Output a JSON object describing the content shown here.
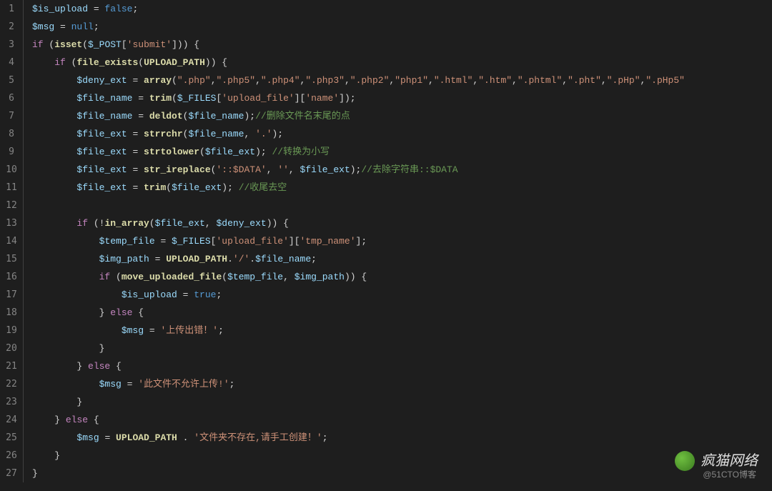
{
  "lineCount": 27,
  "code": {
    "l1": [
      [
        "var",
        "$is_upload"
      ],
      [
        "op",
        " = "
      ],
      [
        "bool",
        "false"
      ],
      [
        "punc",
        ";"
      ]
    ],
    "l2": [
      [
        "var",
        "$msg"
      ],
      [
        "op",
        " = "
      ],
      [
        "bool",
        "null"
      ],
      [
        "punc",
        ";"
      ]
    ],
    "l3": [
      [
        "kw",
        "if"
      ],
      [
        "punc",
        " ("
      ],
      [
        "fn",
        "isset"
      ],
      [
        "punc",
        "("
      ],
      [
        "var",
        "$_POST"
      ],
      [
        "punc",
        "["
      ],
      [
        "str",
        "'submit'"
      ],
      [
        "punc",
        "])) {"
      ]
    ],
    "l4": [
      [
        "plain",
        "    "
      ],
      [
        "kw",
        "if"
      ],
      [
        "punc",
        " ("
      ],
      [
        "fn",
        "file_exists"
      ],
      [
        "punc",
        "("
      ],
      [
        "const",
        "UPLOAD_PATH"
      ],
      [
        "punc",
        ")) {"
      ]
    ],
    "l5": [
      [
        "plain",
        "        "
      ],
      [
        "var",
        "$deny_ext"
      ],
      [
        "op",
        " = "
      ],
      [
        "fn",
        "array"
      ],
      [
        "punc",
        "("
      ],
      [
        "str",
        "\".php\""
      ],
      [
        "punc",
        ","
      ],
      [
        "str",
        "\".php5\""
      ],
      [
        "punc",
        ","
      ],
      [
        "str",
        "\".php4\""
      ],
      [
        "punc",
        ","
      ],
      [
        "str",
        "\".php3\""
      ],
      [
        "punc",
        ","
      ],
      [
        "str",
        "\".php2\""
      ],
      [
        "punc",
        ","
      ],
      [
        "str",
        "\"php1\""
      ],
      [
        "punc",
        ","
      ],
      [
        "str",
        "\".html\""
      ],
      [
        "punc",
        ","
      ],
      [
        "str",
        "\".htm\""
      ],
      [
        "punc",
        ","
      ],
      [
        "str",
        "\".phtml\""
      ],
      [
        "punc",
        ","
      ],
      [
        "str",
        "\".pht\""
      ],
      [
        "punc",
        ","
      ],
      [
        "str",
        "\".pHp\""
      ],
      [
        "punc",
        ","
      ],
      [
        "str",
        "\".pHp5\""
      ]
    ],
    "l6": [
      [
        "plain",
        "        "
      ],
      [
        "var",
        "$file_name"
      ],
      [
        "op",
        " = "
      ],
      [
        "fn",
        "trim"
      ],
      [
        "punc",
        "("
      ],
      [
        "var",
        "$_FILES"
      ],
      [
        "punc",
        "["
      ],
      [
        "str",
        "'upload_file'"
      ],
      [
        "punc",
        "]["
      ],
      [
        "str",
        "'name'"
      ],
      [
        "punc",
        "]);"
      ]
    ],
    "l7": [
      [
        "plain",
        "        "
      ],
      [
        "var",
        "$file_name"
      ],
      [
        "op",
        " = "
      ],
      [
        "fn",
        "deldot"
      ],
      [
        "punc",
        "("
      ],
      [
        "var",
        "$file_name"
      ],
      [
        "punc",
        ");"
      ],
      [
        "cmt",
        "//删除文件名末尾的点"
      ]
    ],
    "l8": [
      [
        "plain",
        "        "
      ],
      [
        "var",
        "$file_ext"
      ],
      [
        "op",
        " = "
      ],
      [
        "fn",
        "strrchr"
      ],
      [
        "punc",
        "("
      ],
      [
        "var",
        "$file_name"
      ],
      [
        "punc",
        ", "
      ],
      [
        "str",
        "'.'"
      ],
      [
        "punc",
        ");"
      ]
    ],
    "l9": [
      [
        "plain",
        "        "
      ],
      [
        "var",
        "$file_ext"
      ],
      [
        "op",
        " = "
      ],
      [
        "fn",
        "strtolower"
      ],
      [
        "punc",
        "("
      ],
      [
        "var",
        "$file_ext"
      ],
      [
        "punc",
        "); "
      ],
      [
        "cmt",
        "//转换为小写"
      ]
    ],
    "l10": [
      [
        "plain",
        "        "
      ],
      [
        "var",
        "$file_ext"
      ],
      [
        "op",
        " = "
      ],
      [
        "fn",
        "str_ireplace"
      ],
      [
        "punc",
        "("
      ],
      [
        "str",
        "'::$DATA'"
      ],
      [
        "punc",
        ", "
      ],
      [
        "str",
        "''"
      ],
      [
        "punc",
        ", "
      ],
      [
        "var",
        "$file_ext"
      ],
      [
        "punc",
        ");"
      ],
      [
        "cmt",
        "//去除字符串::$DATA"
      ]
    ],
    "l11": [
      [
        "plain",
        "        "
      ],
      [
        "var",
        "$file_ext"
      ],
      [
        "op",
        " = "
      ],
      [
        "fn",
        "trim"
      ],
      [
        "punc",
        "("
      ],
      [
        "var",
        "$file_ext"
      ],
      [
        "punc",
        "); "
      ],
      [
        "cmt",
        "//收尾去空"
      ]
    ],
    "l12": [
      [
        "plain",
        ""
      ]
    ],
    "l13": [
      [
        "plain",
        "        "
      ],
      [
        "kw",
        "if"
      ],
      [
        "punc",
        " (!"
      ],
      [
        "fn",
        "in_array"
      ],
      [
        "punc",
        "("
      ],
      [
        "var",
        "$file_ext"
      ],
      [
        "punc",
        ", "
      ],
      [
        "var",
        "$deny_ext"
      ],
      [
        "punc",
        ")) {"
      ]
    ],
    "l14": [
      [
        "plain",
        "            "
      ],
      [
        "var",
        "$temp_file"
      ],
      [
        "op",
        " = "
      ],
      [
        "var",
        "$_FILES"
      ],
      [
        "punc",
        "["
      ],
      [
        "str",
        "'upload_file'"
      ],
      [
        "punc",
        "]["
      ],
      [
        "str",
        "'tmp_name'"
      ],
      [
        "punc",
        "];"
      ]
    ],
    "l15": [
      [
        "plain",
        "            "
      ],
      [
        "var",
        "$img_path"
      ],
      [
        "op",
        " = "
      ],
      [
        "const",
        "UPLOAD_PATH"
      ],
      [
        "punc",
        "."
      ],
      [
        "str",
        "'/'"
      ],
      [
        "punc",
        "."
      ],
      [
        "var",
        "$file_name"
      ],
      [
        "punc",
        ";"
      ]
    ],
    "l16": [
      [
        "plain",
        "            "
      ],
      [
        "kw",
        "if"
      ],
      [
        "punc",
        " ("
      ],
      [
        "fn",
        "move_uploaded_file"
      ],
      [
        "punc",
        "("
      ],
      [
        "var",
        "$temp_file"
      ],
      [
        "punc",
        ", "
      ],
      [
        "var",
        "$img_path"
      ],
      [
        "punc",
        ")) {"
      ]
    ],
    "l17": [
      [
        "plain",
        "                "
      ],
      [
        "var",
        "$is_upload"
      ],
      [
        "op",
        " = "
      ],
      [
        "bool",
        "true"
      ],
      [
        "punc",
        ";"
      ]
    ],
    "l18": [
      [
        "plain",
        "            } "
      ],
      [
        "kw",
        "else"
      ],
      [
        "punc",
        " {"
      ]
    ],
    "l19": [
      [
        "plain",
        "                "
      ],
      [
        "var",
        "$msg"
      ],
      [
        "op",
        " = "
      ],
      [
        "str",
        "'上传出错！'"
      ],
      [
        "punc",
        ";"
      ]
    ],
    "l20": [
      [
        "plain",
        "            }"
      ]
    ],
    "l21": [
      [
        "plain",
        "        } "
      ],
      [
        "kw",
        "else"
      ],
      [
        "punc",
        " {"
      ]
    ],
    "l22": [
      [
        "plain",
        "            "
      ],
      [
        "var",
        "$msg"
      ],
      [
        "op",
        " = "
      ],
      [
        "str",
        "'此文件不允许上传!'"
      ],
      [
        "punc",
        ";"
      ]
    ],
    "l23": [
      [
        "plain",
        "        }"
      ]
    ],
    "l24": [
      [
        "plain",
        "    } "
      ],
      [
        "kw",
        "else"
      ],
      [
        "punc",
        " {"
      ]
    ],
    "l25": [
      [
        "plain",
        "        "
      ],
      [
        "var",
        "$msg"
      ],
      [
        "op",
        " = "
      ],
      [
        "const",
        "UPLOAD_PATH"
      ],
      [
        "punc",
        " . "
      ],
      [
        "str",
        "'文件夹不存在,请手工创建！'"
      ],
      [
        "punc",
        ";"
      ]
    ],
    "l26": [
      [
        "plain",
        "    }"
      ]
    ],
    "l27": [
      [
        "plain",
        "}"
      ]
    ]
  },
  "watermark": {
    "text": "疯猫网络",
    "sub": "@51CTO博客"
  }
}
